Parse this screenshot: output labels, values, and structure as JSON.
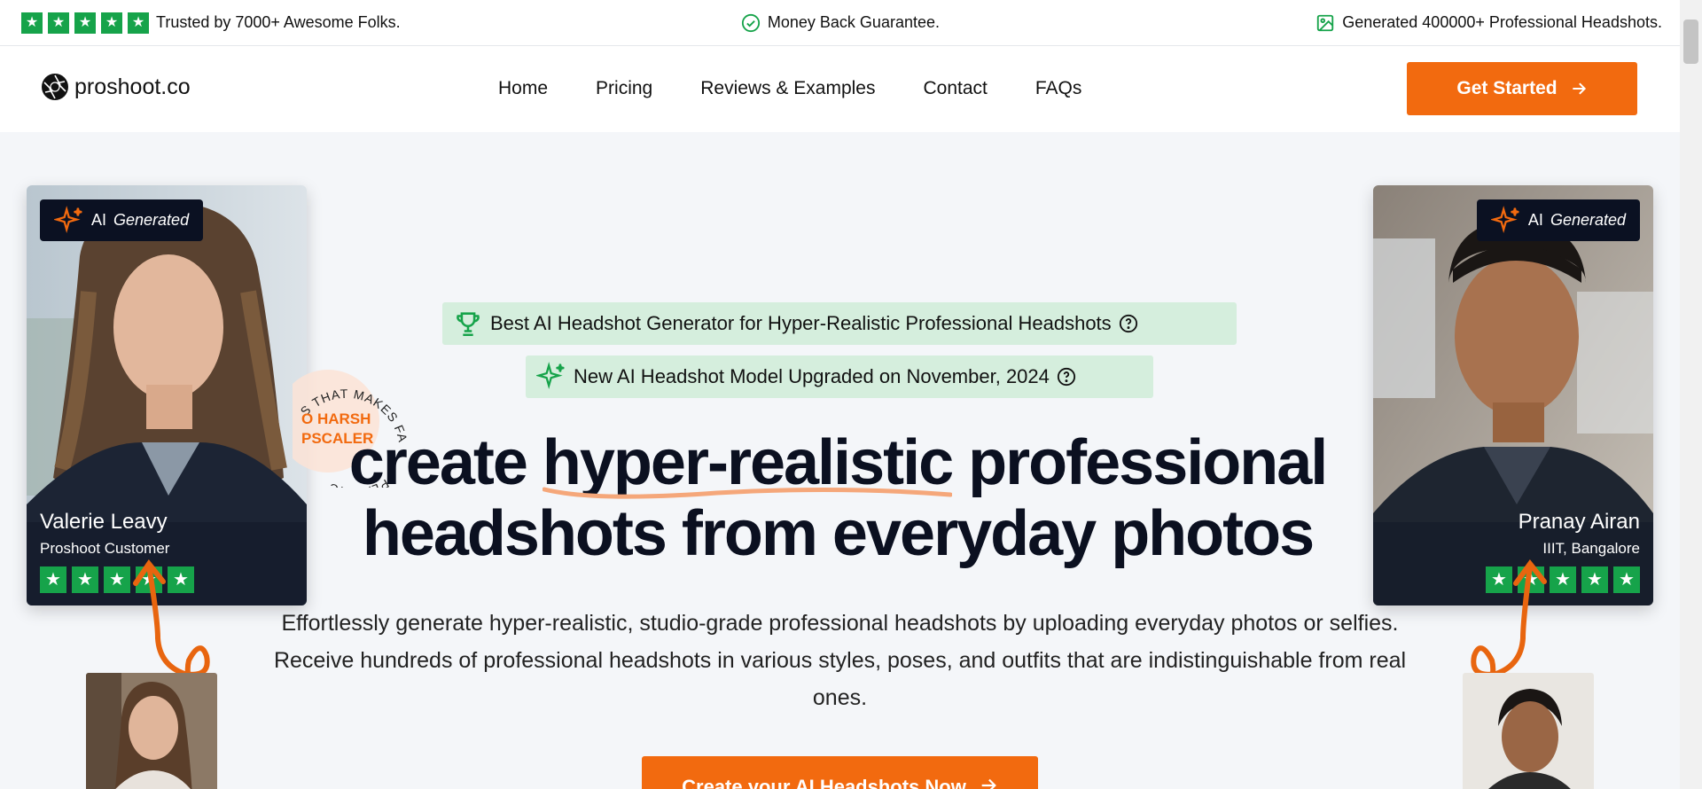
{
  "topbar": {
    "trusted_text": "Trusted by 7000+ Awesome Folks.",
    "guarantee_text": "Money Back Guarantee.",
    "generated_text": "Generated 400000+ Professional Headshots.",
    "star_glyph": "★"
  },
  "nav": {
    "logo_text": "proshoot.co",
    "items": [
      "Home",
      "Pricing",
      "Reviews & Examples",
      "Contact",
      "FAQs"
    ],
    "cta_label": "Get Started"
  },
  "badge": {
    "ai": "AI",
    "generated": "Generated"
  },
  "testimonials": [
    {
      "name": "Valerie Leavy",
      "subtitle": "Proshoot Customer",
      "rating": 5
    },
    {
      "name": "Pranay Airan",
      "subtitle": "IIIT, Bangalore",
      "rating": 5
    }
  ],
  "stamp": {
    "ring_text": "S THAT MAKES FACE LO",
    "ring_text_bottom": "PLASTIC",
    "line1": "O HARSH",
    "line2": "PSCALER"
  },
  "pills": [
    "Best AI Headshot Generator for Hyper-Realistic Professional Headshots",
    "New AI Headshot Model Upgraded on November, 2024"
  ],
  "headline": {
    "part1": "create",
    "highlight": "hyper-realistic",
    "part2": "professional",
    "line2": "headshots from everyday photos"
  },
  "subtext": "Effortlessly generate hyper-realistic, studio-grade professional headshots by uploading everyday photos or selfies. Receive hundreds of professional headshots in various styles, poses, and outfits that are indistinguishable from real ones.",
  "cta": {
    "label": "Create your AI Headshots Now"
  },
  "colors": {
    "accent": "#f26a0f",
    "star_green": "#16a34a",
    "pill_bg": "#d5eedd",
    "badge_bg": "#0b1122",
    "headline": "#0b1020"
  }
}
